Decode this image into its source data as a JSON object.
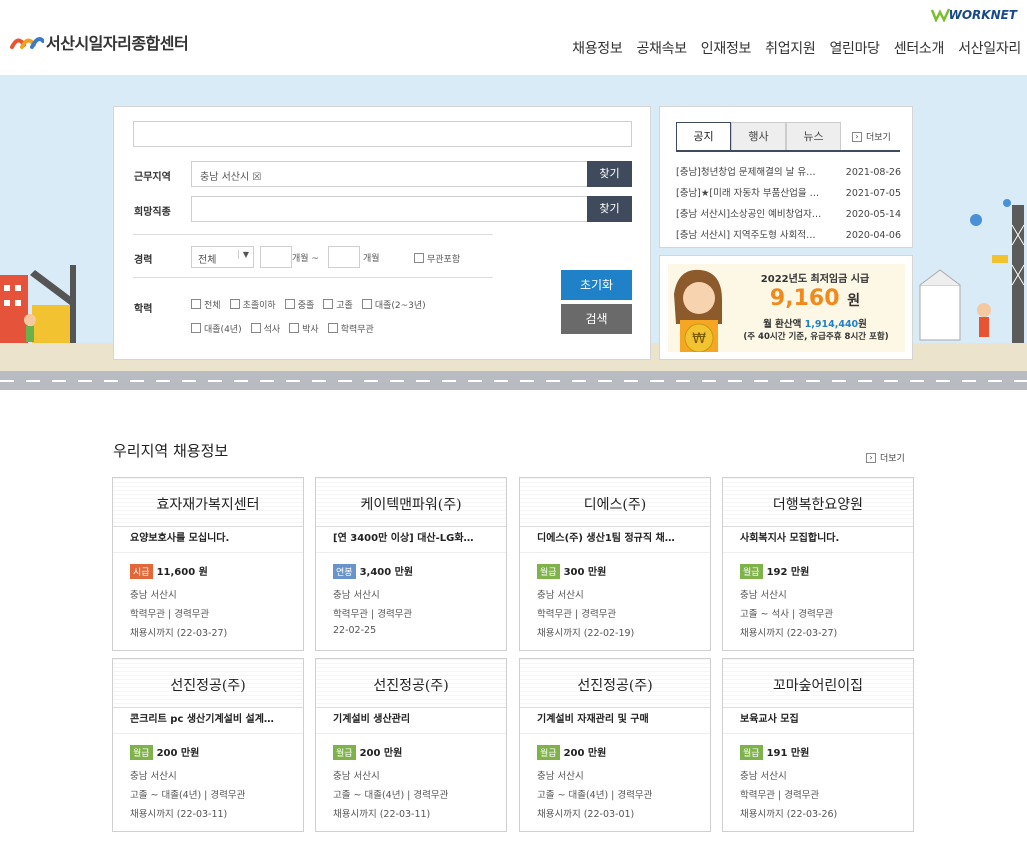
{
  "header": {
    "site_title": "서산시일자리종합센터",
    "worknet_label": "WORKNET",
    "nav": [
      "채용정보",
      "공채속보",
      "인재정보",
      "취업지원",
      "열린마당",
      "센터소개",
      "서산일자리"
    ]
  },
  "search": {
    "keyword_value": "",
    "region_label": "근무지역",
    "region_value": "충남 서산시 ☒",
    "find_label": "찾기",
    "job_label": "희망직종",
    "job_value": "",
    "career_label": "경력",
    "career_select": "전체",
    "career_from_unit": "개월 ~",
    "career_to_unit": "개월",
    "career_any": "무관포함",
    "edu_label": "학력",
    "edu_row1": [
      "전체",
      "초졸이하",
      "중졸",
      "고졸",
      "대졸(2~3년)"
    ],
    "edu_row2": [
      "대졸(4년)",
      "석사",
      "박사",
      "학력무관"
    ],
    "reset_label": "초기화",
    "search_label": "검색"
  },
  "notice": {
    "tabs": [
      "공지",
      "행사",
      "뉴스"
    ],
    "more_label": "더보기",
    "items": [
      {
        "title": "[충남]청년창업 문제해결의 날 유…",
        "date": "2021-08-26"
      },
      {
        "title": "[충남]★[미래 자동차 부품산업을 …",
        "date": "2021-07-05"
      },
      {
        "title": "[충남 서산시]소상공인 예비창업자…",
        "date": "2020-05-14"
      },
      {
        "title": "[충남 서산시] 지역주도형 사회적…",
        "date": "2020-04-06"
      }
    ]
  },
  "banner": {
    "line1": "2022년도 최저임금 시급",
    "amount": "9,160",
    "amount_unit": "원",
    "monthly_prefix": "월 환산액",
    "monthly_value": "1,914,440",
    "monthly_unit": "원",
    "note": "(주 40시간 기준, 유급주휴 8시간 포함)"
  },
  "jobs": {
    "section_title": "우리지역 채용정보",
    "more_label": "더보기",
    "colors": {
      "hourly": "#e0683a",
      "annual": "#6a93c9",
      "monthly": "#7fb24a"
    },
    "cards": [
      {
        "company": "효자재가복지센터",
        "title": "요양보호사를 모십니다.",
        "pay_type": "시급",
        "pay_kind": "hourly",
        "pay": "11,600 원",
        "loc": "충남 서산시",
        "req": "학력무관 | 경력무관",
        "deadline": "채용시까지 (22-03-27)"
      },
      {
        "company": "케이텍맨파워(주)",
        "title": "[연 3400만 이상] 대산-LG화…",
        "pay_type": "연봉",
        "pay_kind": "annual",
        "pay": "3,400 만원",
        "loc": "충남 서산시",
        "req": "학력무관 | 경력무관",
        "deadline": "22-02-25"
      },
      {
        "company": "디에스(주)",
        "title": "디에스(주) 생산1팀 정규직 채…",
        "pay_type": "월급",
        "pay_kind": "monthly",
        "pay": "300 만원",
        "loc": "충남 서산시",
        "req": "학력무관 | 경력무관",
        "deadline": "채용시까지 (22-02-19)"
      },
      {
        "company": "더행복한요양원",
        "title": "사회복지사 모집합니다.",
        "pay_type": "월급",
        "pay_kind": "monthly",
        "pay": "192 만원",
        "loc": "충남 서산시",
        "req": "고졸 ~ 석사 | 경력무관",
        "deadline": "채용시까지 (22-03-27)"
      },
      {
        "company": "선진정공(주)",
        "title": "콘크리트 pc 생산기계설비 설계…",
        "pay_type": "월급",
        "pay_kind": "monthly",
        "pay": "200 만원",
        "loc": "충남 서산시",
        "req": "고졸 ~ 대졸(4년) | 경력무관",
        "deadline": "채용시까지 (22-03-11)"
      },
      {
        "company": "선진정공(주)",
        "title": "기계설비 생산관리",
        "pay_type": "월급",
        "pay_kind": "monthly",
        "pay": "200 만원",
        "loc": "충남 서산시",
        "req": "고졸 ~ 대졸(4년) | 경력무관",
        "deadline": "채용시까지 (22-03-11)"
      },
      {
        "company": "선진정공(주)",
        "title": "기계설비 자재관리 및 구매",
        "pay_type": "월급",
        "pay_kind": "monthly",
        "pay": "200 만원",
        "loc": "충남 서산시",
        "req": "고졸 ~ 대졸(4년) | 경력무관",
        "deadline": "채용시까지 (22-03-01)"
      },
      {
        "company": "꼬마숲어린이집",
        "title": "보육교사 모집",
        "pay_type": "월급",
        "pay_kind": "monthly",
        "pay": "191 만원",
        "loc": "충남 서산시",
        "req": "학력무관 | 경력무관",
        "deadline": "채용시까지 (22-03-26)"
      }
    ]
  }
}
